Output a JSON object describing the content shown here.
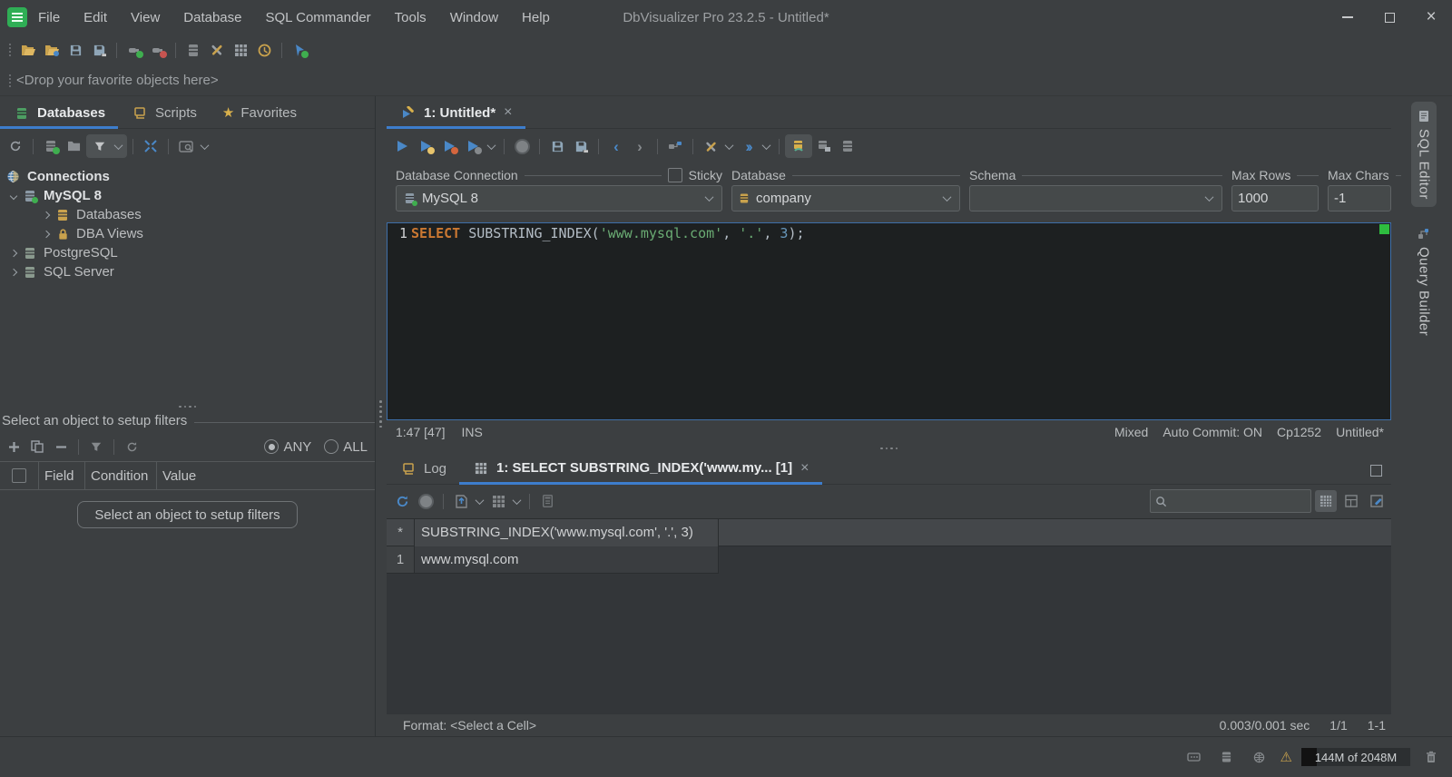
{
  "window": {
    "title": "DbVisualizer Pro 23.2.5 - Untitled*",
    "menus": [
      "File",
      "Edit",
      "View",
      "Database",
      "SQL Commander",
      "Tools",
      "Window",
      "Help"
    ]
  },
  "main_toolbar": {
    "icons": [
      "open-folder-icon",
      "open-favorite-folder-icon",
      "save-icon",
      "save-as-icon",
      "connect-icon",
      "disconnect-icon",
      "commit-server-icon",
      "tools-icon",
      "table-grid-icon",
      "driver-manager-icon",
      "create-object-icon"
    ]
  },
  "favorites_bar": {
    "text": "<Drop your favorite objects here>"
  },
  "left_panel": {
    "tabs": [
      {
        "label": "Databases",
        "active": true
      },
      {
        "label": "Scripts",
        "active": false
      },
      {
        "label": "Favorites",
        "active": false
      }
    ],
    "tree": {
      "root": "Connections",
      "items": [
        {
          "label": "MySQL 8"
        },
        {
          "label": "Databases"
        },
        {
          "label": "DBA Views"
        },
        {
          "label": "PostgreSQL"
        },
        {
          "label": "SQL Server"
        }
      ]
    },
    "filter": {
      "header": "Select an object to setup filters",
      "any": "ANY",
      "all": "ALL",
      "columns": [
        "Field",
        "Condition",
        "Value"
      ],
      "button": "Select an object to setup filters"
    }
  },
  "editor": {
    "tab": "1: Untitled*",
    "fields": {
      "connection_label": "Database Connection",
      "sticky": "Sticky",
      "database_label": "Database",
      "schema_label": "Schema",
      "max_rows_label": "Max Rows",
      "max_chars_label": "Max Chars",
      "connection": "MySQL 8",
      "database": "company",
      "schema": "",
      "max_rows": "1000",
      "max_chars": "-1"
    },
    "line_number": "1",
    "sql_tokens": [
      {
        "t": "SELECT",
        "c": "kw"
      },
      {
        "t": " SUBSTRING_INDEX(",
        "c": "pl"
      },
      {
        "t": "'www.mysql.com'",
        "c": "st"
      },
      {
        "t": ", ",
        "c": "pl"
      },
      {
        "t": "'.'",
        "c": "st"
      },
      {
        "t": ", ",
        "c": "pl"
      },
      {
        "t": "3",
        "c": "nu"
      },
      {
        "t": ");",
        "c": "pl"
      }
    ],
    "status": {
      "position": "1:47 [47]",
      "mode": "INS",
      "right": [
        "Mixed",
        "Auto Commit: ON",
        "Cp1252",
        "Untitled*"
      ]
    }
  },
  "results": {
    "log_tab": "Log",
    "tab": "1: SELECT SUBSTRING_INDEX('www.my... [1]",
    "grid": {
      "corner": "*",
      "column": "SUBSTRING_INDEX('www.mysql.com', '.', 3)",
      "rows": [
        {
          "n": "1",
          "value": "www.mysql.com"
        }
      ]
    },
    "status": {
      "format": "Format: <Select a Cell>",
      "time": "0.003/0.001 sec",
      "rows": "1/1",
      "cell": "1-1"
    }
  },
  "right_sidebar": {
    "tabs": [
      {
        "label": "SQL Editor",
        "active": true
      },
      {
        "label": "Query Builder",
        "active": false
      }
    ]
  },
  "status_bar": {
    "memory": "144M of 2048M"
  },
  "colors": {
    "accent_blue": "#3d7dcc",
    "keyword_orange": "#cb7832",
    "string_green": "#6aab73",
    "number_blue": "#6897bb",
    "health_green": "#2ebd3f",
    "icon_yellow": "#c9a24d"
  }
}
